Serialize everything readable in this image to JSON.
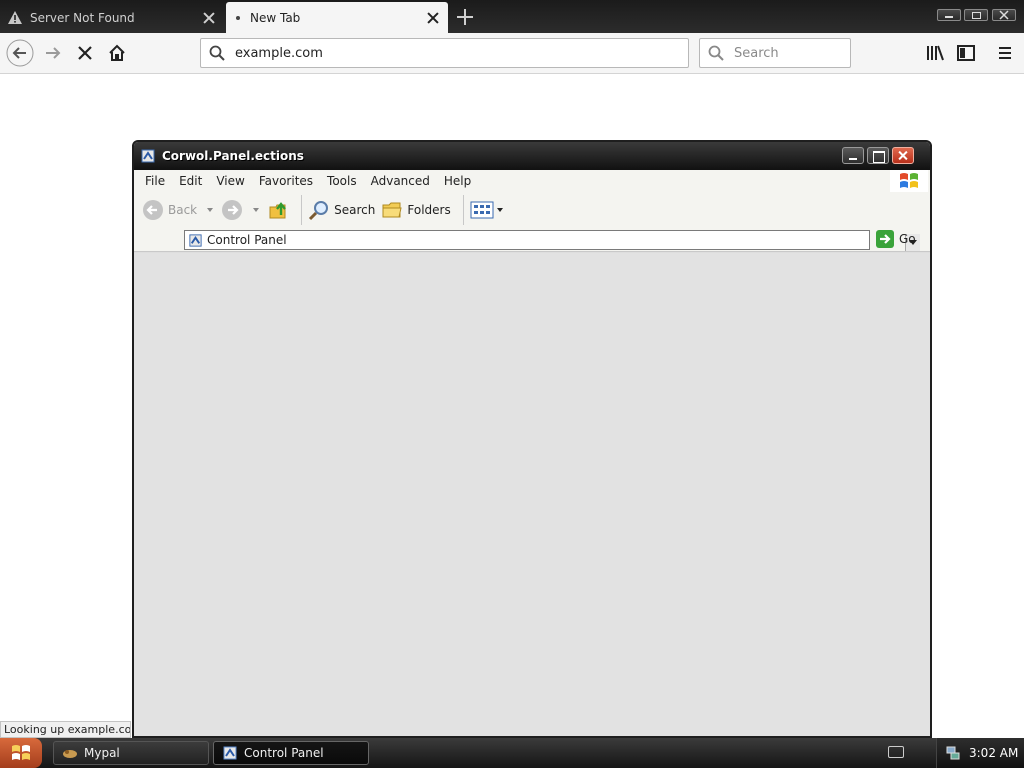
{
  "browser": {
    "tabs": [
      {
        "label": "Server Not Found",
        "active": false
      },
      {
        "label": "New Tab",
        "active": true
      }
    ],
    "url": "example.com",
    "search_placeholder": "Search",
    "status_text": "Looking up example.com..."
  },
  "xp_window": {
    "title": "Corwol.Panel.ections",
    "menu": [
      "File",
      "Edit",
      "View",
      "Favorites",
      "Tools",
      "Advanced",
      "Help"
    ],
    "toolbar": {
      "back_label": "Back",
      "search_label": "Search",
      "folders_label": "Folders"
    },
    "address_value": "Control Panel",
    "go_label": "Go"
  },
  "taskbar": {
    "items": [
      {
        "label": "Mypal",
        "active": false
      },
      {
        "label": "Control Panel",
        "active": true
      }
    ],
    "clock": "3:02 AM"
  },
  "colors": {
    "accent_start": "#c8502a",
    "xp_close": "#c9402a",
    "go_green": "#3aa33a"
  }
}
